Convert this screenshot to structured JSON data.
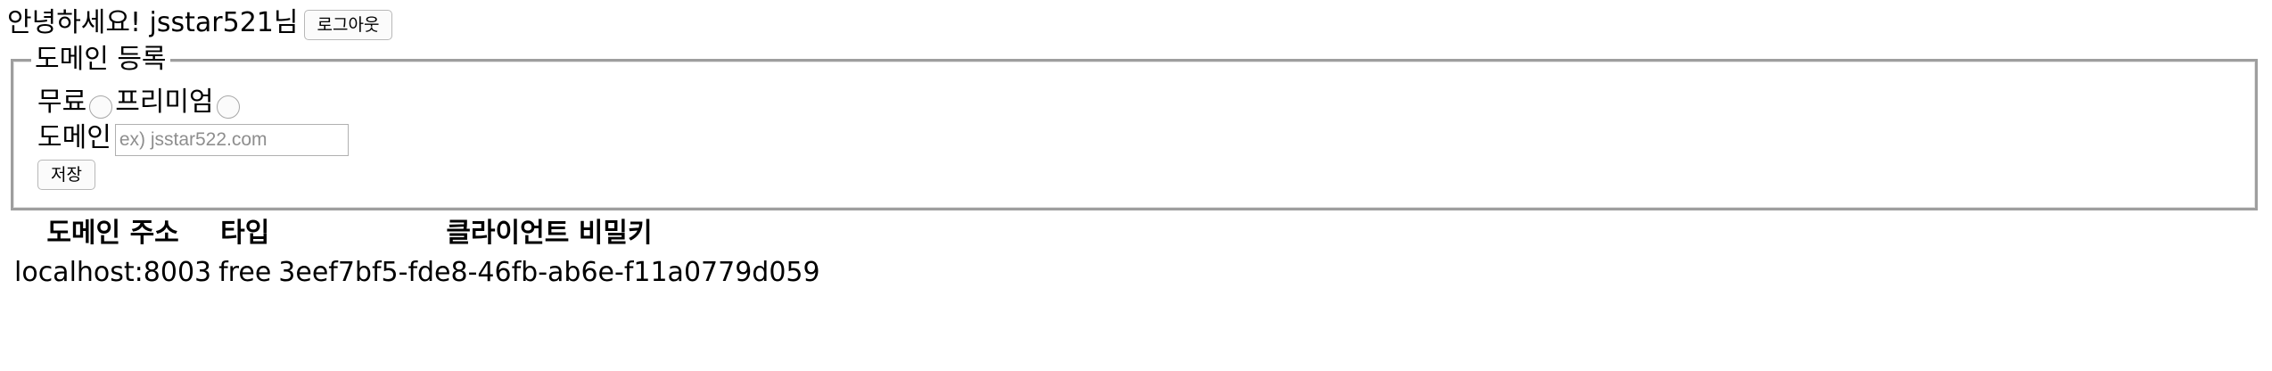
{
  "header": {
    "greeting": "안녕하세요! jsstar521님",
    "logout_label": "로그아웃"
  },
  "register_form": {
    "legend": "도메인 등록",
    "plan_options": [
      {
        "label": "무료",
        "checked": false
      },
      {
        "label": "프리미엄",
        "checked": false
      }
    ],
    "domain_label": "도메인",
    "domain_value": "",
    "domain_placeholder": "ex) jsstar522.com",
    "save_label": "저장"
  },
  "domain_table": {
    "columns": [
      "도메인 주소",
      "타입",
      "클라이언트 비밀키"
    ],
    "rows": [
      [
        "localhost:8003",
        "free",
        "3eef7bf5-fde8-46fb-ab6e-f11a0779d059"
      ]
    ]
  }
}
